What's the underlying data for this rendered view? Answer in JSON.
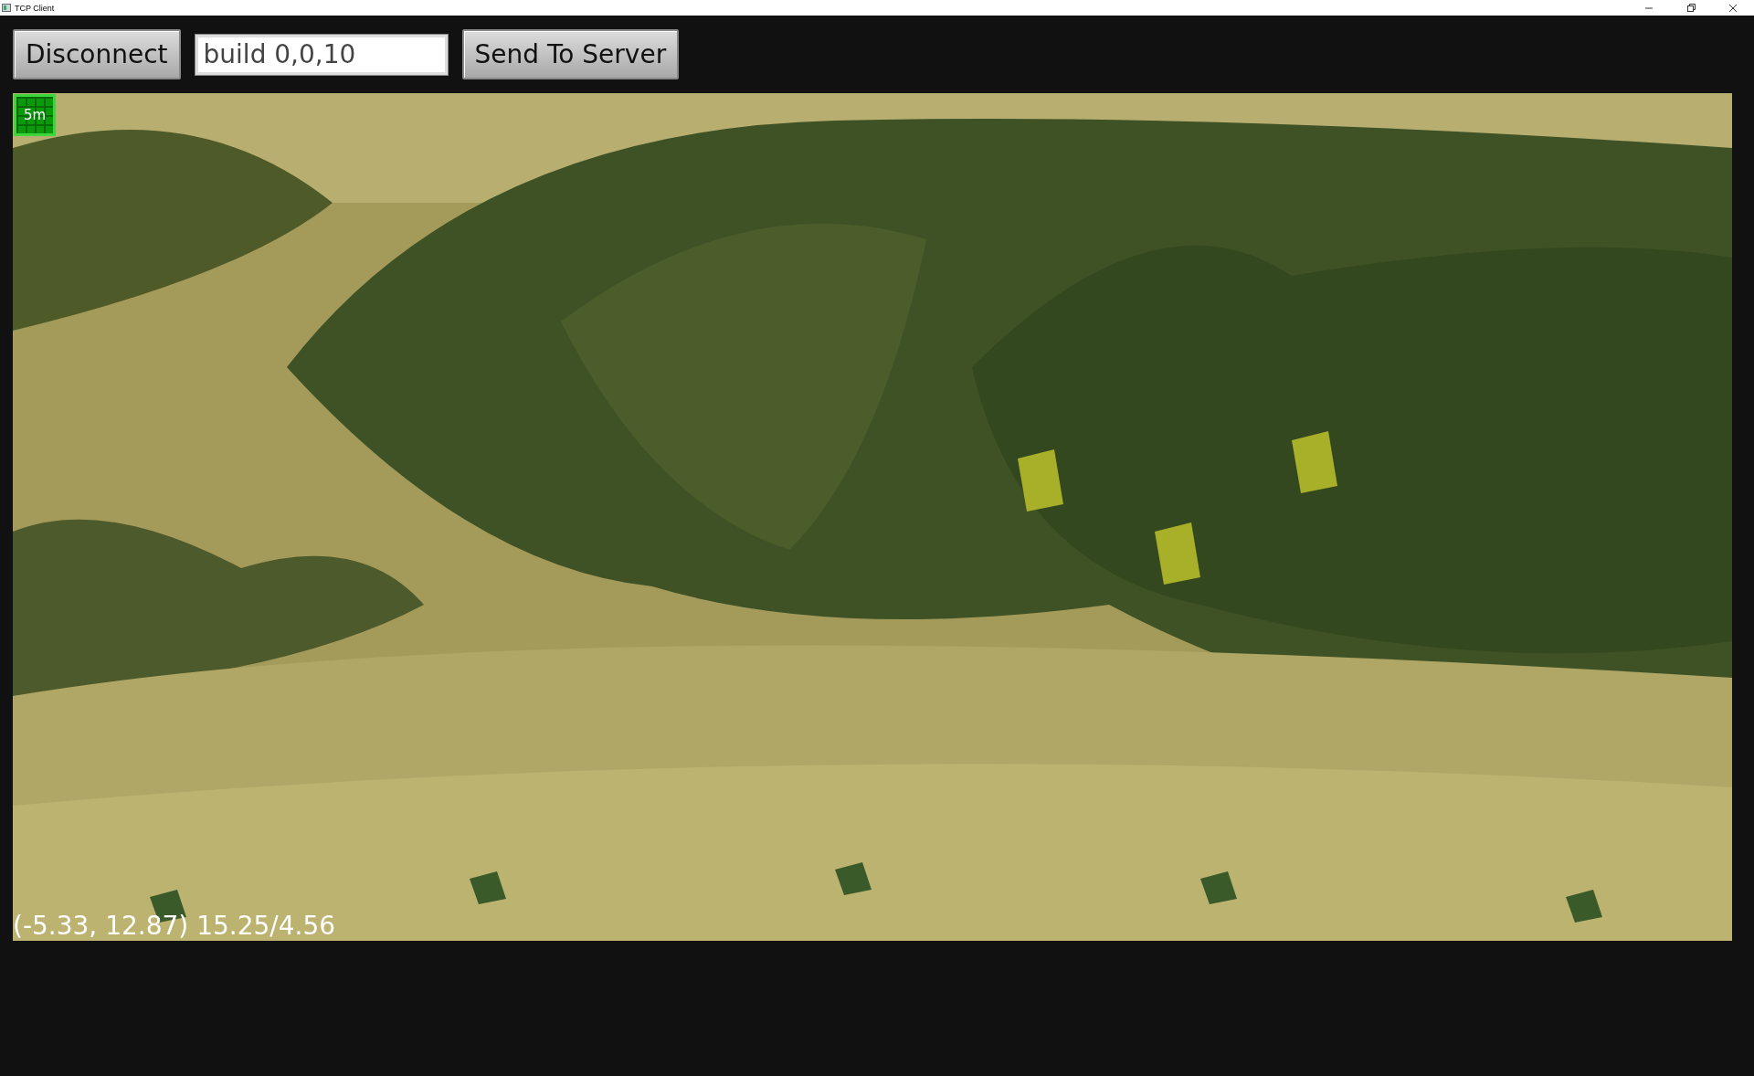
{
  "window": {
    "title": "TCP Client"
  },
  "toolbar": {
    "connect_button": "Disconnect",
    "command_field": {
      "value": "build 0,0,10"
    },
    "send_button": "Send To Server"
  },
  "viewport": {
    "kind": "picture",
    "scale_label": "5m",
    "coordinates": "(-5.33, 12.87) 15.25/4.56"
  }
}
